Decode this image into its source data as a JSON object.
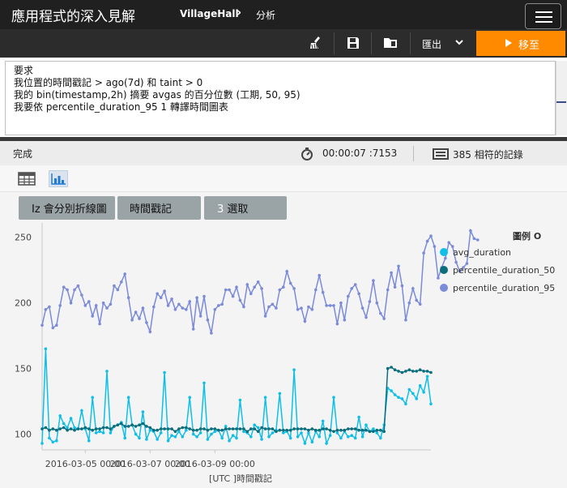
{
  "header": {
    "app_title": "應用程式的深入見解",
    "breadcrumb": [
      "VillageHall",
      "分析"
    ]
  },
  "toolbar": {
    "export_label": "匯出",
    "goto_label": "移至",
    "icons": [
      "broom-icon",
      "save-icon",
      "open-folder-icon",
      "chevron-down-icon",
      "play-icon"
    ]
  },
  "query": {
    "lines": [
      "要求",
      " 我位置的時間戳記 > ago(7d) 和 taint > 0",
      "我的 bin(timestamp,2h) 摘要 avgas 的百分位數 (工期, 50, 95)",
      " 我要依 percentile_duration_95 1 轉譯時間圖表"
    ]
  },
  "status": {
    "state": "完成",
    "elapsed": "00:00:07 :7153",
    "records": "385 相符的記錄"
  },
  "chart_controls": {
    "split_button": "Iz 會分別折線圖",
    "x_select": "時間戳記",
    "y_select_count": "3",
    "y_select_label": "選取"
  },
  "colors": {
    "avg_duration": "#10bfe8",
    "percentile_duration_50": "#0a6e7d",
    "percentile_duration_95": "#7b8bd8",
    "accent": "#ff8a00"
  },
  "chart_data": {
    "type": "line",
    "title": "",
    "xlabel": "[UTC ]時間戳記",
    "legend_title": "圖例 O",
    "legend_position": "right",
    "ylim": [
      88,
      256
    ],
    "yticks": [
      100,
      150,
      200,
      250
    ],
    "x_tick_labels": [
      "2016-03-05 00:00",
      "2016-03-07 00:00",
      "2016-03-09 00:00"
    ],
    "x_tick_index": [
      12,
      30,
      48
    ],
    "series": [
      {
        "name": "avg_duration",
        "values": [
          93,
          165,
          97,
          94,
          95,
          114,
          108,
          105,
          112,
          105,
          104,
          118,
          104,
          95,
          128,
          101,
          102,
          101,
          148,
          101,
          106,
          107,
          109,
          97,
          128,
          107,
          100,
          97,
          117,
          96,
          103,
          102,
          96,
          101,
          147,
          95,
          99,
          98,
          102,
          98,
          103,
          128,
          100,
          98,
          101,
          139,
          96,
          100,
          102,
          103,
          97,
          106,
          95,
          99,
          97,
          126,
          102,
          101,
          98,
          107,
          105,
          96,
          128,
          98,
          101,
          103,
          131,
          101,
          102,
          97,
          149,
          98,
          101,
          93,
          101,
          94,
          102,
          98,
          110,
          93,
          99,
          128,
          101,
          97,
          102,
          98,
          99,
          97,
          113,
          98,
          107,
          102,
          104,
          101,
          97,
          107,
          135,
          133,
          130,
          128,
          127,
          123,
          134,
          131,
          127,
          137,
          132,
          144,
          123
        ]
      },
      {
        "name": "percentile_duration_50",
        "values": [
          104,
          105,
          103,
          104,
          103,
          104,
          105,
          103,
          104,
          103,
          104,
          104,
          105,
          104,
          103,
          104,
          104,
          105,
          105,
          104,
          106,
          107,
          108,
          106,
          106,
          107,
          106,
          107,
          108,
          106,
          105,
          103,
          103,
          104,
          104,
          104,
          104,
          102,
          104,
          105,
          105,
          104,
          103,
          103,
          104,
          104,
          103,
          104,
          104,
          103,
          103,
          104,
          104,
          104,
          104,
          104,
          104,
          102,
          104,
          104,
          102,
          105,
          104,
          104,
          104,
          102,
          103,
          103,
          103,
          103,
          104,
          104,
          104,
          104,
          103,
          104,
          103,
          103,
          104,
          104,
          103,
          102,
          103,
          103,
          103,
          104,
          104,
          104,
          103,
          103,
          103,
          102,
          102,
          103,
          103,
          102,
          150,
          151,
          149,
          148,
          147,
          148,
          149,
          148,
          148,
          149,
          148,
          148,
          147
        ]
      },
      {
        "name": "percentile_duration_95",
        "values": [
          183,
          195,
          197,
          181,
          183,
          198,
          212,
          210,
          200,
          210,
          213,
          206,
          198,
          201,
          190,
          198,
          184,
          200,
          196,
          199,
          213,
          210,
          216,
          222,
          204,
          187,
          193,
          188,
          196,
          185,
          178,
          197,
          207,
          204,
          209,
          198,
          203,
          195,
          199,
          196,
          195,
          201,
          180,
          204,
          190,
          205,
          187,
          177,
          195,
          198,
          199,
          210,
          210,
          205,
          212,
          202,
          197,
          214,
          207,
          212,
          216,
          211,
          190,
          197,
          199,
          196,
          210,
          212,
          224,
          215,
          211,
          195,
          196,
          186,
          197,
          195,
          210,
          221,
          208,
          198,
          198,
          198,
          184,
          200,
          187,
          205,
          211,
          214,
          207,
          196,
          189,
          201,
          217,
          200,
          192,
          188,
          210,
          223,
          212,
          228,
          213,
          187,
          200,
          211,
          202,
          199,
          238,
          247,
          251,
          243,
          219,
          227,
          234,
          246,
          243,
          231,
          224,
          227,
          230,
          255,
          249,
          248
        ]
      }
    ]
  }
}
